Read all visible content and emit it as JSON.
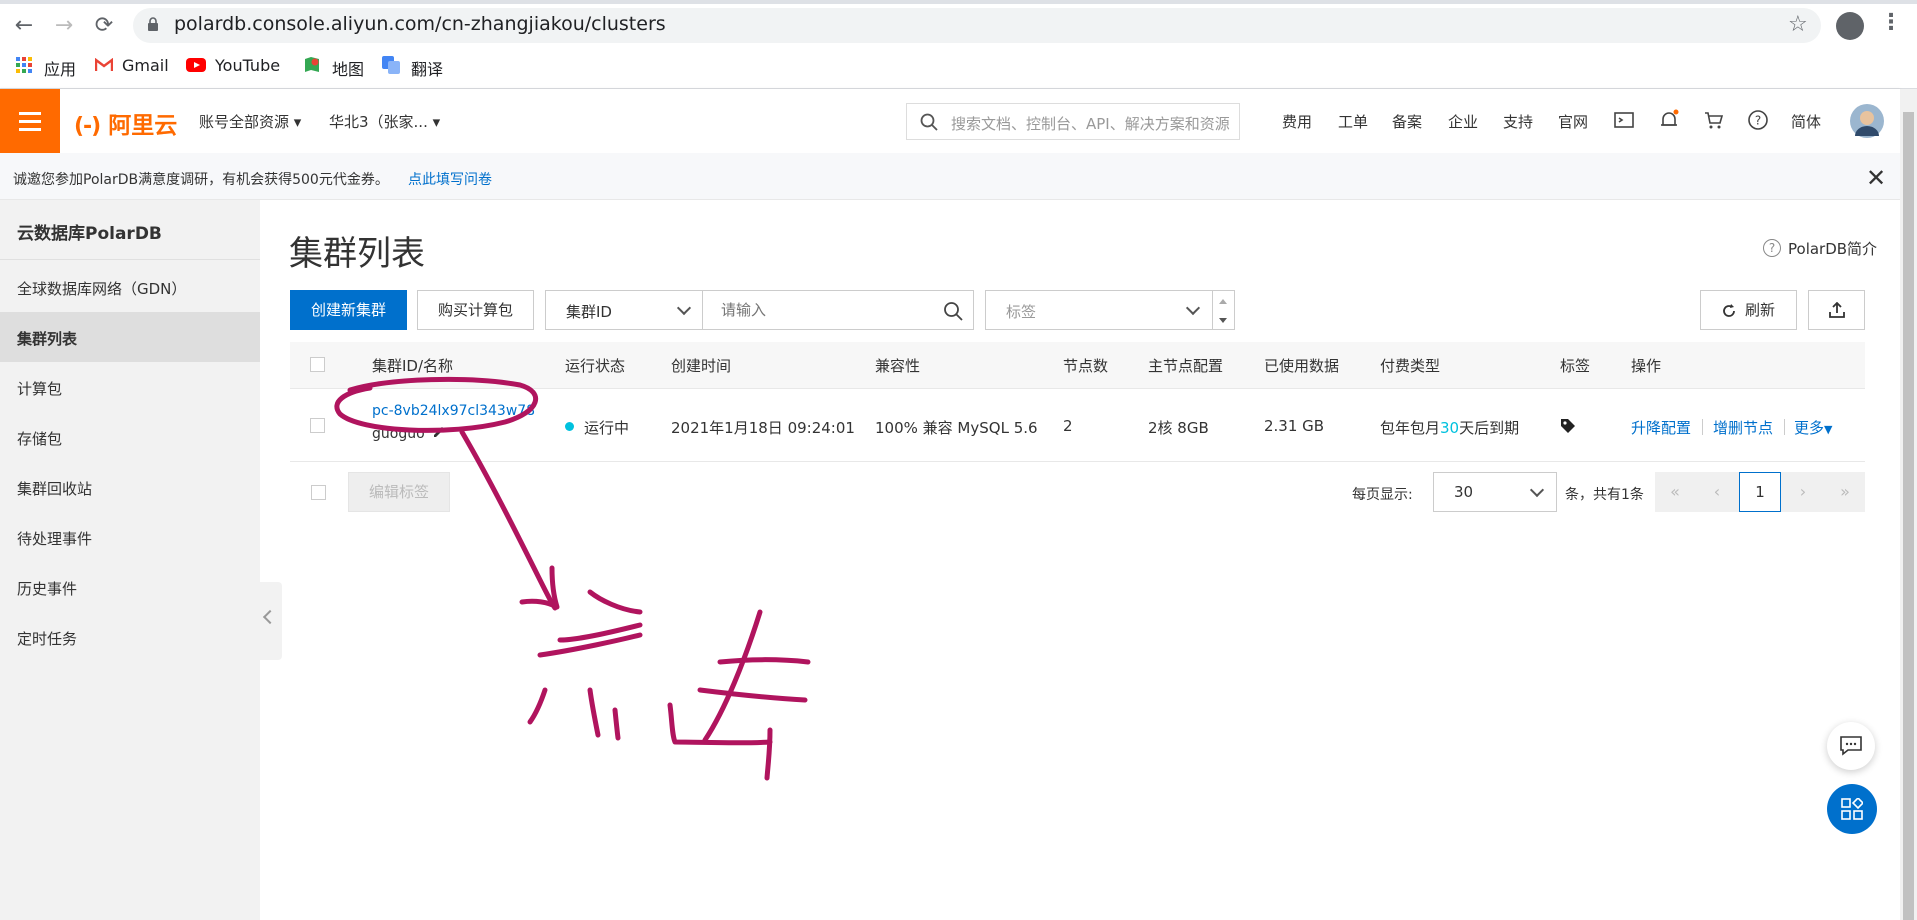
{
  "browser": {
    "url": "polardb.console.aliyun.com/cn-zhangjiakou/clusters",
    "bookmarks": [
      "应用",
      "Gmail",
      "YouTube",
      "地图",
      "翻译"
    ]
  },
  "header": {
    "logo": "阿里云",
    "resources": "账号全部资源",
    "region": "华北3（张家...",
    "search_placeholder": "搜索文档、控制台、API、解决方案和资源",
    "links": [
      "费用",
      "工单",
      "备案",
      "企业",
      "支持",
      "官网"
    ],
    "lang": "简体"
  },
  "notice": {
    "text": "诚邀您参加PolarDB满意度调研，有机会获得500元代金券。",
    "link": "点此填写问卷"
  },
  "sidebar": {
    "title": "云数据库PolarDB",
    "items": [
      {
        "label": "全球数据库网络（GDN）"
      },
      {
        "label": "集群列表"
      },
      {
        "label": "计算包"
      },
      {
        "label": "存储包"
      },
      {
        "label": "集群回收站"
      },
      {
        "label": "待处理事件"
      },
      {
        "label": "历史事件"
      },
      {
        "label": "定时任务"
      }
    ]
  },
  "main": {
    "title": "集群列表",
    "intro": "PolarDB简介",
    "toolbar": {
      "create": "创建新集群",
      "buy": "购买计算包",
      "field": "集群ID",
      "search_placeholder": "请输入",
      "tag_placeholder": "标签",
      "refresh": "刷新"
    },
    "table": {
      "columns": [
        "集群ID/名称",
        "运行状态",
        "创建时间",
        "兼容性",
        "节点数",
        "主节点配置",
        "已使用数据",
        "付费类型",
        "标签",
        "操作"
      ],
      "row": {
        "id": "pc-8vb24lx97cl343w78",
        "name": "guoguo",
        "status": "运行中",
        "created": "2021年1月18日 09:24:01",
        "compat": "100% 兼容 MySQL 5.6",
        "nodes": "2",
        "spec": "2核 8GB",
        "used": "2.31 GB",
        "billing_pre": "包年包月",
        "billing_days": "30",
        "billing_post": "天后到期",
        "ops": [
          "升降配置",
          "增删节点",
          "更多"
        ]
      }
    },
    "footer": {
      "edit_tags": "编辑标签",
      "page_size_label": "每页显示:",
      "page_size": "30",
      "total": "条，共有1条",
      "current_page": "1"
    }
  },
  "annotation": {
    "note": "点击"
  },
  "colors": {
    "brand": "#ff6a00",
    "primary": "#0070cc",
    "status_running": "#00c1de",
    "annotation": "#b0145e"
  }
}
